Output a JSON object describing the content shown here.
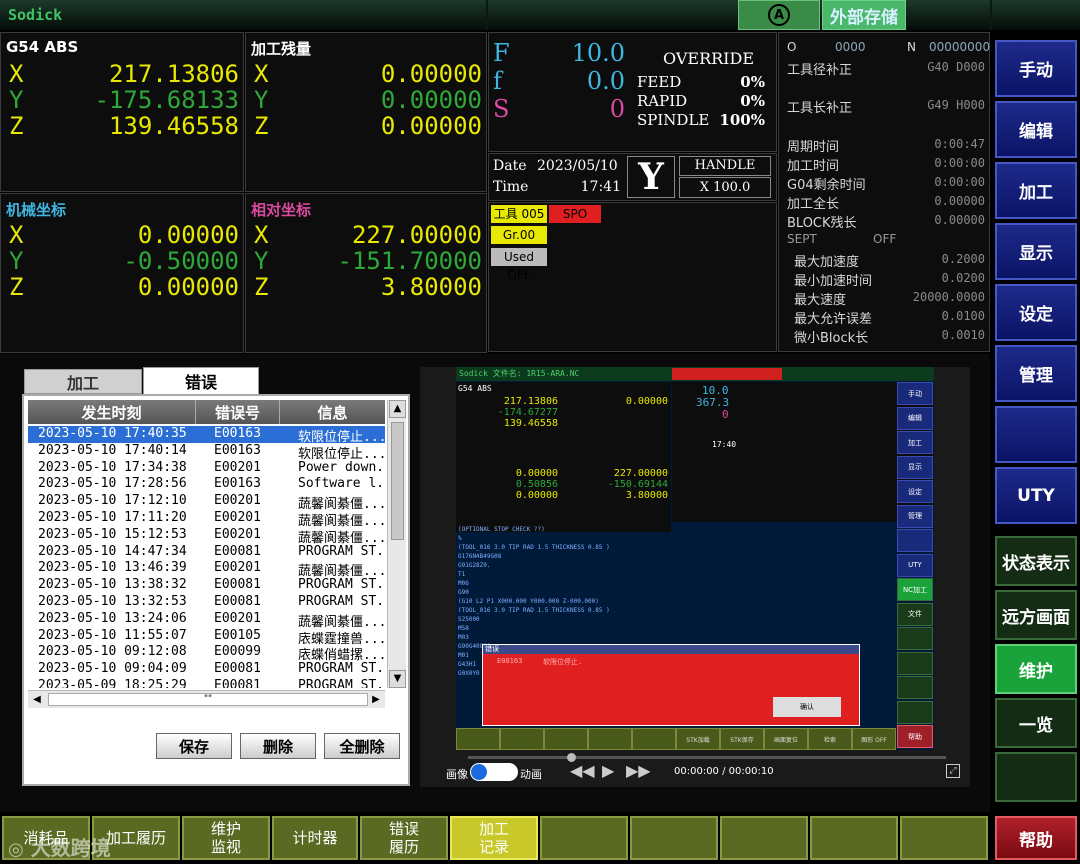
{
  "header": {
    "logo": "Sodick",
    "auto_icon": "A",
    "external_storage": "外部存储"
  },
  "abs_panel": {
    "title": "G54 ABS",
    "rows": [
      {
        "axis": "X",
        "value": "217.13806"
      },
      {
        "axis": "Y",
        "value": "-175.68133"
      },
      {
        "axis": "Z",
        "value": "139.46558"
      }
    ]
  },
  "remain_panel": {
    "title": "加工残量",
    "rows": [
      {
        "axis": "X",
        "value": "0.00000"
      },
      {
        "axis": "Y",
        "value": "0.00000"
      },
      {
        "axis": "Z",
        "value": "0.00000"
      }
    ]
  },
  "machine_panel": {
    "title": "机械坐标",
    "rows": [
      {
        "axis": "X",
        "value": "0.00000"
      },
      {
        "axis": "Y",
        "value": "-0.50000"
      },
      {
        "axis": "Z",
        "value": "0.00000"
      }
    ]
  },
  "relative_panel": {
    "title": "相对坐标",
    "rows": [
      {
        "axis": "X",
        "value": "227.00000"
      },
      {
        "axis": "Y",
        "value": "-151.70000"
      },
      {
        "axis": "Z",
        "value": "3.80000"
      }
    ]
  },
  "fs_panel": {
    "F": "F",
    "F_value": "10.0",
    "f": "f",
    "f_value": "0.0",
    "S": "S",
    "S_value": "0",
    "override": "OVERRIDE",
    "feed_label": "FEED",
    "feed_value": "0%",
    "rapid_label": "RAPID",
    "rapid_value": "0%",
    "spindle_label": "SPINDLE",
    "spindle_value": "100%"
  },
  "datetime": {
    "date_label": "Date",
    "date": "2023/05/10",
    "time_label": "Time",
    "time": "17:41"
  },
  "handle": {
    "axis": "Y",
    "label": "HANDLE",
    "value": "X 100.0"
  },
  "status_tags": {
    "tool": "工具 005",
    "spo": "SPO",
    "gr": "Gr.00",
    "used": "Used OFF"
  },
  "right_info": {
    "o_label": "O",
    "o_value": "0000",
    "n_label": "N",
    "n_value": "00000000",
    "tool_radius": "工具径补正",
    "tool_radius_val": "G40 D000",
    "tool_length": "工具长补正",
    "tool_length_val": "G49 H000",
    "items": [
      {
        "label": "周期时间",
        "value": "0:00:47"
      },
      {
        "label": "加工时间",
        "value": "0:00:00"
      },
      {
        "label": "G04剩余时间",
        "value": "0:00:00"
      },
      {
        "label": "加工全长",
        "value": "0.00000"
      },
      {
        "label": "BLOCK残长",
        "value": "0.00000"
      }
    ],
    "sept_label": "SEPT",
    "sept_value": "OFF",
    "params": [
      {
        "label": "最大加速度",
        "value": "0.2000"
      },
      {
        "label": "最小加速时间",
        "value": "0.0200"
      },
      {
        "label": "最大速度",
        "value": "20000.0000"
      },
      {
        "label": "最大允许误差",
        "value": "0.0100"
      },
      {
        "label": "微小Block长",
        "value": "0.0010"
      }
    ]
  },
  "right_menu": [
    "手动",
    "编辑",
    "加工",
    "显示",
    "设定",
    "管理",
    "",
    "UTY"
  ],
  "right_menu2": [
    "状态表示",
    "远方画面",
    "维护",
    "一览",
    ""
  ],
  "help": "帮助",
  "bottom_menu": [
    {
      "l1": "消耗品",
      "l2": ""
    },
    {
      "l1": "加工履历",
      "l2": ""
    },
    {
      "l1": "维护",
      "l2": "监视"
    },
    {
      "l1": "计时器",
      "l2": ""
    },
    {
      "l1": "错误",
      "l2": "履历"
    },
    {
      "l1": "加工",
      "l2": "记录"
    },
    {
      "l1": "",
      "l2": ""
    },
    {
      "l1": "",
      "l2": ""
    },
    {
      "l1": "",
      "l2": ""
    },
    {
      "l1": "",
      "l2": ""
    },
    {
      "l1": "",
      "l2": ""
    }
  ],
  "watermark": "大数跨境",
  "error_window": {
    "tabs": [
      "加工",
      "错误"
    ],
    "headers": [
      "发生时刻",
      "错误号",
      "信息"
    ],
    "rows": [
      [
        "2023-05-10 17:40:35",
        "E00163",
        "软限位停止..."
      ],
      [
        "2023-05-10 17:40:14",
        "E00163",
        "软限位停止..."
      ],
      [
        "2023-05-10 17:34:38",
        "E00201",
        "Power down..."
      ],
      [
        "2023-05-10 17:28:56",
        "E00163",
        "Software l..."
      ],
      [
        "2023-05-10 17:12:10",
        "E00201",
        "蔬馨阆綦僵..."
      ],
      [
        "2023-05-10 17:11:20",
        "E00201",
        "蔬馨阆綦僵..."
      ],
      [
        "2023-05-10 15:12:53",
        "E00201",
        "蔬馨阆綦僵..."
      ],
      [
        "2023-05-10 14:47:34",
        "E00081",
        "PROGRAM ST..."
      ],
      [
        "2023-05-10 13:46:39",
        "E00201",
        "蔬馨阆綦僵..."
      ],
      [
        "2023-05-10 13:38:32",
        "E00081",
        "PROGRAM ST..."
      ],
      [
        "2023-05-10 13:32:53",
        "E00081",
        "PROGRAM ST..."
      ],
      [
        "2023-05-10 13:24:06",
        "E00201",
        "蔬馨阆綦僵..."
      ],
      [
        "2023-05-10 11:55:07",
        "E00105",
        "庡蝶霆撞兽..."
      ],
      [
        "2023-05-10 09:12:08",
        "E00099",
        "庡蝶俏蜡摞..."
      ],
      [
        "2023-05-10 09:04:09",
        "E00081",
        "PROGRAM ST..."
      ],
      [
        "2023-05-09 18:25:29",
        "E00081",
        "PROGRAM ST..."
      ]
    ],
    "hscroll_mark": "\"\"",
    "save": "保存",
    "delete": "删除",
    "delete_all": "全删除"
  },
  "video": {
    "title": "Sodick 文件名: 1R15-ARA.NC",
    "mini_abs": [
      "217.13806",
      "-174.67277",
      "139.46558"
    ],
    "mini_rel": [
      "227.00000",
      "-150.69144",
      "3.80000"
    ],
    "mini_machine": [
      "0.00000",
      "0.50856",
      "0.00000"
    ],
    "mini_F": "10.0",
    "mini_f": "367.3",
    "mini_S": "0",
    "mini_time": "17:40",
    "program_lines": [
      "(OPTIONAL STOP CHECK ??)",
      "%",
      "(TOOL_016 3.0 TIP RAD 1.5 THICKNESS 0.85 )",
      "O176N4B49G08",
      "G91G28Z0.",
      "T1",
      "M06",
      "G90",
      "(G10 L2 P1 X000.000 Y000.000 Z-000.000)",
      "(TOOL_016 3.0 TIP RAD 1.5 THICKNESS 0.85 )",
      "S25000",
      "M58",
      "M03",
      "G90G40G80",
      "M01",
      "G43H1",
      "G0X0Y0"
    ],
    "dialog_title": "错误",
    "dialog_code": "E00163",
    "dialog_msg": "软限位停止.",
    "dialog_btn": "确认",
    "mini_right": [
      "手动",
      "编辑",
      "加工",
      "显示",
      "设定",
      "管理",
      "",
      "UTY",
      "NC加工",
      "文件",
      "",
      "",
      "",
      "",
      "帮助"
    ],
    "mini_bottom": [
      "",
      "",
      "",
      "",
      "",
      "STK加载",
      "STK保存",
      "画面复位",
      "检索",
      "图形 OFF"
    ],
    "toggle_left": "画像",
    "toggle_right": "动画",
    "timecode": "00:00:00 / 00:00:10"
  }
}
